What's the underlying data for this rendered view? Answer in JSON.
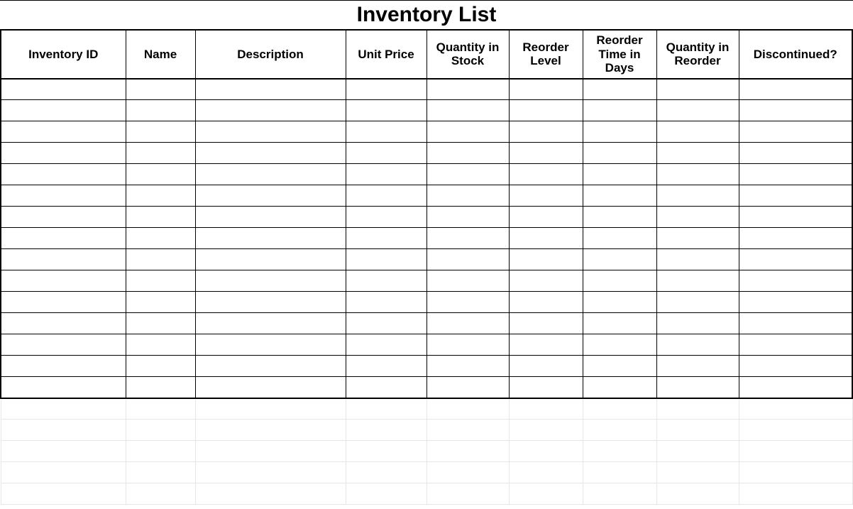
{
  "title": "Inventory List",
  "columns": [
    {
      "key": "inventory_id",
      "label": "Inventory ID"
    },
    {
      "key": "name",
      "label": "Name"
    },
    {
      "key": "description",
      "label": "Description"
    },
    {
      "key": "unit_price",
      "label": "Unit Price"
    },
    {
      "key": "quantity_in_stock",
      "label": "Quantity in Stock"
    },
    {
      "key": "reorder_level",
      "label": "Reorder Level"
    },
    {
      "key": "reorder_time_in_days",
      "label": "Reorder Time in Days"
    },
    {
      "key": "quantity_in_reorder",
      "label": "Quantity in Reorder"
    },
    {
      "key": "discontinued",
      "label": "Discontinued?"
    }
  ],
  "rows": [
    {
      "inventory_id": "",
      "name": "",
      "description": "",
      "unit_price": "",
      "quantity_in_stock": "",
      "reorder_level": "",
      "reorder_time_in_days": "",
      "quantity_in_reorder": "",
      "discontinued": ""
    },
    {
      "inventory_id": "",
      "name": "",
      "description": "",
      "unit_price": "",
      "quantity_in_stock": "",
      "reorder_level": "",
      "reorder_time_in_days": "",
      "quantity_in_reorder": "",
      "discontinued": ""
    },
    {
      "inventory_id": "",
      "name": "",
      "description": "",
      "unit_price": "",
      "quantity_in_stock": "",
      "reorder_level": "",
      "reorder_time_in_days": "",
      "quantity_in_reorder": "",
      "discontinued": ""
    },
    {
      "inventory_id": "",
      "name": "",
      "description": "",
      "unit_price": "",
      "quantity_in_stock": "",
      "reorder_level": "",
      "reorder_time_in_days": "",
      "quantity_in_reorder": "",
      "discontinued": ""
    },
    {
      "inventory_id": "",
      "name": "",
      "description": "",
      "unit_price": "",
      "quantity_in_stock": "",
      "reorder_level": "",
      "reorder_time_in_days": "",
      "quantity_in_reorder": "",
      "discontinued": ""
    },
    {
      "inventory_id": "",
      "name": "",
      "description": "",
      "unit_price": "",
      "quantity_in_stock": "",
      "reorder_level": "",
      "reorder_time_in_days": "",
      "quantity_in_reorder": "",
      "discontinued": ""
    },
    {
      "inventory_id": "",
      "name": "",
      "description": "",
      "unit_price": "",
      "quantity_in_stock": "",
      "reorder_level": "",
      "reorder_time_in_days": "",
      "quantity_in_reorder": "",
      "discontinued": ""
    },
    {
      "inventory_id": "",
      "name": "",
      "description": "",
      "unit_price": "",
      "quantity_in_stock": "",
      "reorder_level": "",
      "reorder_time_in_days": "",
      "quantity_in_reorder": "",
      "discontinued": ""
    },
    {
      "inventory_id": "",
      "name": "",
      "description": "",
      "unit_price": "",
      "quantity_in_stock": "",
      "reorder_level": "",
      "reorder_time_in_days": "",
      "quantity_in_reorder": "",
      "discontinued": ""
    },
    {
      "inventory_id": "",
      "name": "",
      "description": "",
      "unit_price": "",
      "quantity_in_stock": "",
      "reorder_level": "",
      "reorder_time_in_days": "",
      "quantity_in_reorder": "",
      "discontinued": ""
    },
    {
      "inventory_id": "",
      "name": "",
      "description": "",
      "unit_price": "",
      "quantity_in_stock": "",
      "reorder_level": "",
      "reorder_time_in_days": "",
      "quantity_in_reorder": "",
      "discontinued": ""
    },
    {
      "inventory_id": "",
      "name": "",
      "description": "",
      "unit_price": "",
      "quantity_in_stock": "",
      "reorder_level": "",
      "reorder_time_in_days": "",
      "quantity_in_reorder": "",
      "discontinued": ""
    },
    {
      "inventory_id": "",
      "name": "",
      "description": "",
      "unit_price": "",
      "quantity_in_stock": "",
      "reorder_level": "",
      "reorder_time_in_days": "",
      "quantity_in_reorder": "",
      "discontinued": ""
    },
    {
      "inventory_id": "",
      "name": "",
      "description": "",
      "unit_price": "",
      "quantity_in_stock": "",
      "reorder_level": "",
      "reorder_time_in_days": "",
      "quantity_in_reorder": "",
      "discontinued": ""
    },
    {
      "inventory_id": "",
      "name": "",
      "description": "",
      "unit_price": "",
      "quantity_in_stock": "",
      "reorder_level": "",
      "reorder_time_in_days": "",
      "quantity_in_reorder": "",
      "discontinued": ""
    }
  ],
  "ghost_row_count": 5
}
